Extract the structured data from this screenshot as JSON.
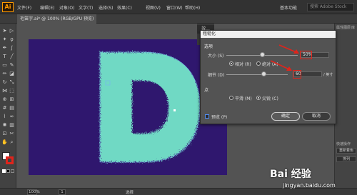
{
  "app": {
    "logo": "Ai"
  },
  "menubar": {
    "items": [
      "文件(F)",
      "编辑(E)",
      "对象(O)",
      "文字(T)",
      "选择(S)",
      "效果(C)",
      "视图(V)",
      "窗口(W)",
      "帮助(H)"
    ],
    "workspace": "基本功能",
    "search_placeholder": "搜索 Adobe Stock"
  },
  "document_tab": {
    "title": "毛笛字.ai* @ 100% (RGB/GPU 预览)"
  },
  "panel_button": {
    "label": "效..."
  },
  "properties_panel": {
    "tabs": [
      "属性",
      "图层",
      "库"
    ],
    "buttons": [
      "重新着色",
      "排列"
    ],
    "section": "快速操作"
  },
  "dialog": {
    "title": "粗糙化",
    "options_heading": "选项",
    "size_label": "大小 (S)",
    "size_value": "50%",
    "relative_label": "相对 (R)",
    "absolute_label": "绝对 (A)",
    "detail_label": "细节 (D)",
    "detail_value": "60",
    "detail_unit": "/ 英寸",
    "point_heading": "点",
    "smooth_label": "平滑 (M)",
    "corner_label": "尖锐 (C)",
    "preview_label": "预览 (P)",
    "ok_label": "确定",
    "cancel_label": "取消",
    "size_slider_fraction": 0.5,
    "detail_slider_fraction": 0.6
  },
  "statusbar": {
    "zoom": "100%",
    "page": "1",
    "tool": "选择"
  },
  "watermark": {
    "main": "Bai 经验",
    "sub": "jingyan.baidu.com"
  },
  "colors": {
    "artboard": "#2f176e",
    "fur": "#6fd9c4",
    "highlight": "#e0241b"
  }
}
